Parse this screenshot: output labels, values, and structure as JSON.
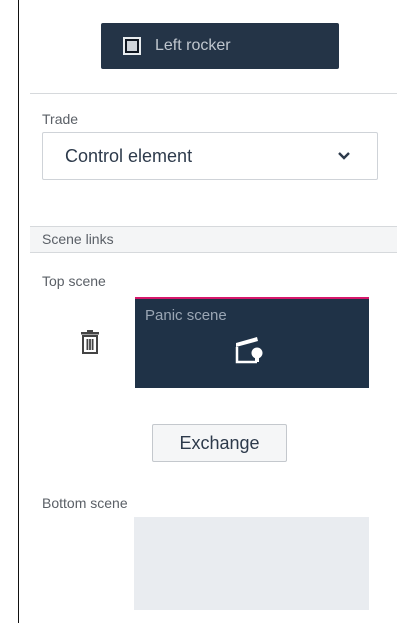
{
  "header": {
    "button_label": "Left rocker",
    "icon": "rocker-square-icon"
  },
  "trade": {
    "label": "Trade",
    "selected": "Control element",
    "chevron_icon": "chevron-down-icon"
  },
  "scene_links": {
    "section_title": "Scene links",
    "top": {
      "label": "Top scene",
      "scene_name": "Panic scene",
      "scene_icon": "panic-scene-icon",
      "delete_icon": "trash-icon",
      "accent_color": "#d6186b"
    },
    "exchange_label": "Exchange",
    "bottom": {
      "label": "Bottom scene"
    }
  },
  "colors": {
    "tile_bg": "#1f3247",
    "header_bg": "#243447"
  }
}
